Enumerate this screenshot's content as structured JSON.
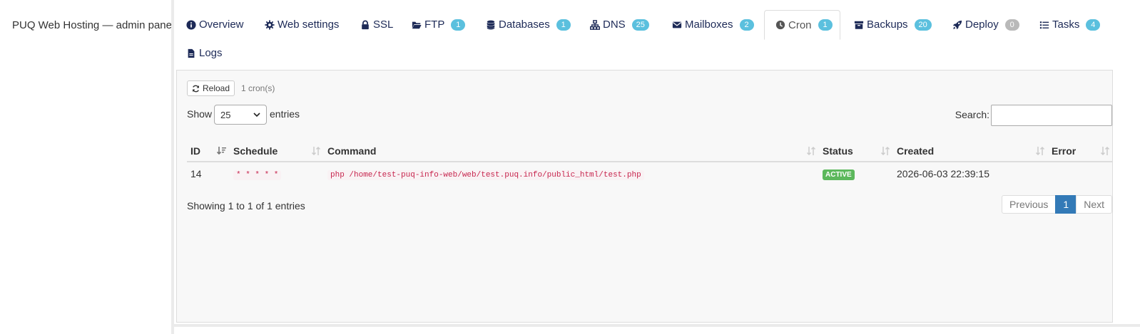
{
  "brand": {
    "title": "PUQ Web Hosting — admin panel"
  },
  "tabs": [
    {
      "label": "Overview",
      "icon": "info-circle-icon"
    },
    {
      "label": "Web settings",
      "icon": "gear-icon"
    },
    {
      "label": "SSL",
      "icon": "lock-icon"
    },
    {
      "label": "FTP",
      "icon": "folder-open-icon",
      "badge": "1"
    },
    {
      "label": "Databases",
      "icon": "database-icon",
      "badge": "1"
    },
    {
      "label": "DNS",
      "icon": "sitemap-icon",
      "badge": "25"
    },
    {
      "label": "Mailboxes",
      "icon": "envelope-icon",
      "badge": "2"
    },
    {
      "label": "Cron",
      "icon": "clock-icon",
      "badge": "1",
      "active": true
    },
    {
      "label": "Backups",
      "icon": "archive-icon",
      "badge": "20"
    },
    {
      "label": "Deploy",
      "icon": "rocket-icon",
      "badge": "0"
    },
    {
      "label": "Tasks",
      "icon": "list-icon",
      "badge": "4"
    },
    {
      "label": "Logs",
      "icon": "file-icon"
    }
  ],
  "toolbar": {
    "reload_label": "Reload",
    "cron_count": "1 cron(s)"
  },
  "length": {
    "show_label": "Show",
    "selected": "25",
    "entries_label": "entries"
  },
  "search": {
    "label": "Search:",
    "value": ""
  },
  "table": {
    "columns": [
      "ID",
      "Schedule",
      "Command",
      "Status",
      "Created",
      "Error"
    ],
    "rows": [
      {
        "id": "14",
        "schedule": "* * * * *",
        "command": "php /home/test-puq-info-web/web/test.puq.info/public_html/test.php",
        "status": "ACTIVE",
        "created": "2026-06-03 22:39:15",
        "error": ""
      }
    ]
  },
  "footer": {
    "info": "Showing 1 to 1 of 1 entries"
  },
  "pagination": {
    "previous": "Previous",
    "current": "1",
    "next": "Next"
  },
  "colors": {
    "accent": "#337ab7",
    "badge": "#5bc0de",
    "badge_zero": "#b9b9b9",
    "status_active": "#5cb85c",
    "code": "#c7254e"
  }
}
